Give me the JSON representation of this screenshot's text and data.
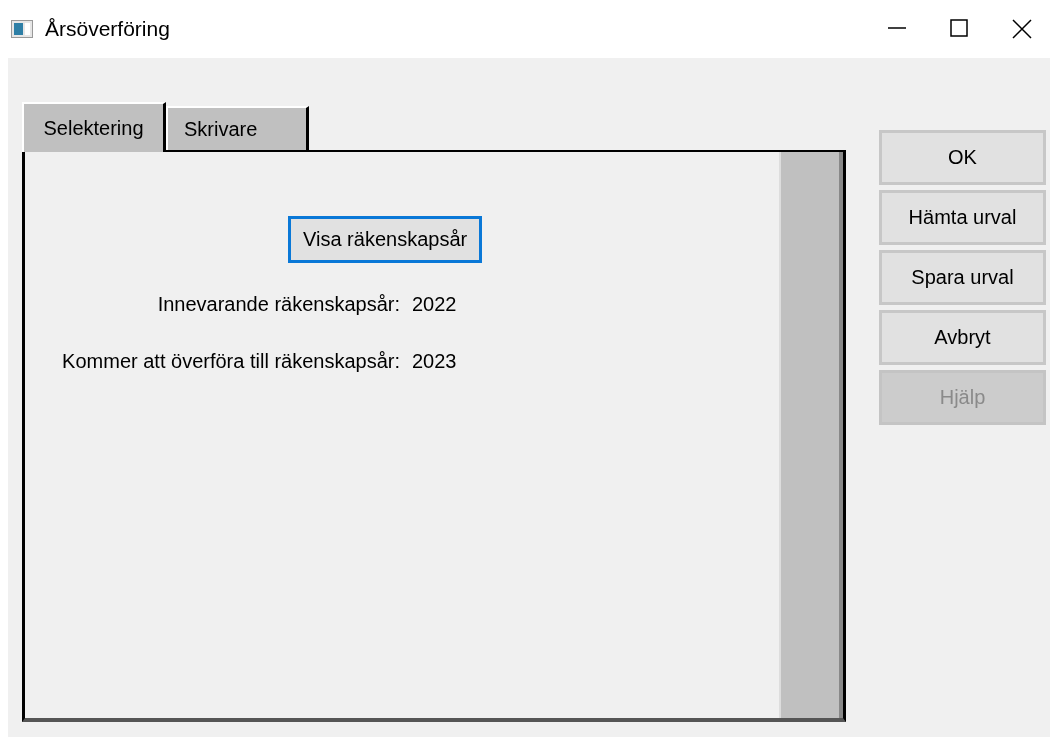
{
  "window": {
    "title": "Årsöverföring"
  },
  "tabs": [
    {
      "label": "Selektering",
      "selected": true
    },
    {
      "label": "Skrivare",
      "selected": false
    }
  ],
  "panel": {
    "action_button": {
      "label": "Visa räkenskapsår",
      "focused": true
    },
    "fields": [
      {
        "label": "Innevarande räkenskapsår:",
        "value": "2022"
      },
      {
        "label": "Kommer att överföra till räkenskapsår:",
        "value": "2023"
      }
    ]
  },
  "buttons": [
    {
      "label": "OK",
      "disabled": false
    },
    {
      "label": "Hämta urval",
      "disabled": false
    },
    {
      "label": "Spara urval",
      "disabled": false
    },
    {
      "label": "Avbryt",
      "disabled": false
    },
    {
      "label": "Hjälp",
      "disabled": true
    }
  ]
}
